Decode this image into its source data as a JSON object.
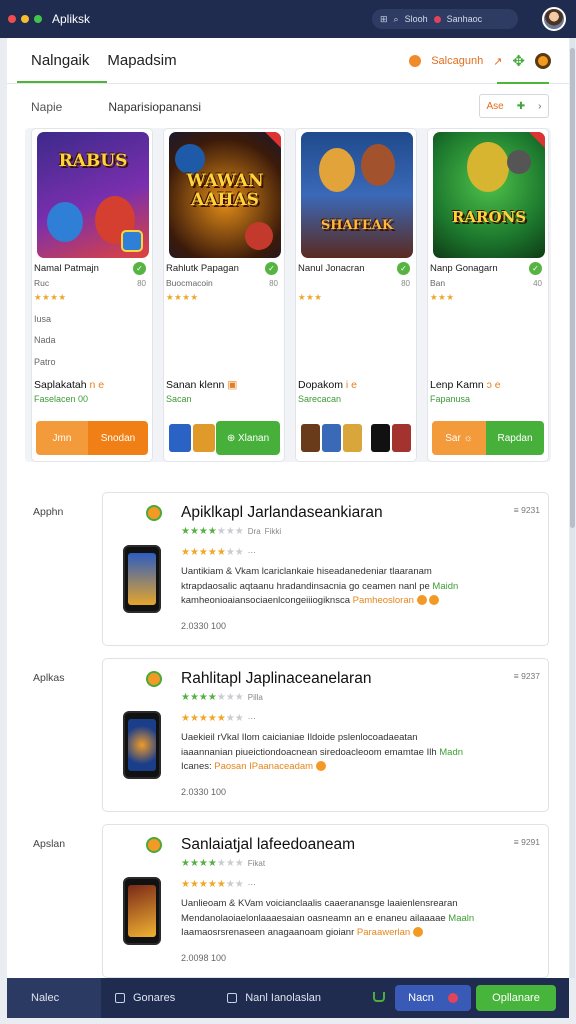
{
  "window": {
    "title": "Apliksk",
    "search_text": "Slooh",
    "record_text": "Sanhaoc"
  },
  "tabs": [
    {
      "label": "Nalngaik"
    },
    {
      "label": "Mapadsim"
    }
  ],
  "tab_actions": {
    "label": "Salcagunh"
  },
  "filter": {
    "left": "Napie",
    "title": "Naparisiopanansi",
    "button": "Ase"
  },
  "featured": [
    {
      "art_title": "RABUS",
      "name": "Namal Patmajn",
      "dev": "Ruc",
      "count": "80",
      "stars": "★★★★",
      "extra": [
        "Iusa",
        "Nada",
        "Patro"
      ],
      "title_main": "Saplakatah",
      "title_acc": "n e",
      "sub": "Faselacen 00",
      "btn1": "Jmn",
      "btn2": "Snodan",
      "art_colors": [
        "#3c2a8a",
        "#e0433b",
        "#2f7fd6"
      ]
    },
    {
      "art_title": "WAWAN AAHAS",
      "name": "Rahlutk Papagan",
      "dev": "Buocmacoin",
      "count": "80",
      "stars": "★★★★",
      "extra": [],
      "title_main": "Sanan klenn",
      "title_acc": "",
      "sub": "Sacan",
      "btn1": "",
      "btn2": "Xlanan",
      "art_colors": [
        "#1a1a2e",
        "#e38d18",
        "#c33a2c"
      ]
    },
    {
      "art_title": "SHAFEAK",
      "name": "Nanul Jonacran",
      "dev": "",
      "count": "80",
      "stars": "★★★",
      "extra": [],
      "title_main": "Dopakom",
      "title_acc": "i e",
      "sub": "Sarecacan",
      "btn1": "",
      "btn2": "",
      "art_colors": [
        "#1f4a8c",
        "#e2a33a",
        "#5a2a1f"
      ]
    },
    {
      "art_title": "RARONS",
      "name": "Nanp Gonagarn",
      "dev": "Ban",
      "count": "40",
      "stars": "★★★",
      "extra": [],
      "title_main": "Lenp Kamn",
      "title_acc": "ɔ e",
      "sub": "Fapanusa",
      "btn1": "Sar",
      "btn2": "Rapdan",
      "art_colors": [
        "#1d7a2e",
        "#d8b531",
        "#6a3b1b"
      ]
    }
  ],
  "list": [
    {
      "label": "Apphn",
      "title": "Apiklkapl Jarlandaseankiaran",
      "meta": "≡ 9231",
      "rating_sub": "Fikki",
      "rating_sub2": "Dra",
      "desc1": "Uantikiam & Vkam lcariclankaie hiseadanedeniar tlaaranam",
      "desc2": "ktrapdaosalic aqtaanu hradandinsacnia go ceamen nanl pe ",
      "desc2_acc": "Maidn",
      "desc3": "kamheonioaiansociaenlcongeiiiogiknsca ",
      "desc3_acc": "Pamheosloran",
      "date": "2.0330 100",
      "screen": [
        "#2d5cc0",
        "#e5a52c"
      ]
    },
    {
      "label": "Aplkas",
      "title": "Rahlitapl Japlinaceanelaran",
      "meta": "≡ 9237",
      "rating_sub": "Pilla",
      "rating_sub2": "",
      "desc1": "Uaekieil rVkal Ilom caicianiae Ildoide pslenlocoadaeatan",
      "desc2": "iaaannanian piueictiondoacnean siredoacleoom emamtae Ilh ",
      "desc2_acc": "Madn",
      "desc3": "Icanes: ",
      "desc3_acc": "Paosan IPaanaceadam",
      "date": "2.0330 100",
      "screen": [
        "#1b3e8a",
        "#ef9b2a"
      ]
    },
    {
      "label": "Apslan",
      "title": "Sanlaiatjal lafeedoaneam",
      "meta": "≡ 9291",
      "rating_sub": "Fikat",
      "rating_sub2": "",
      "desc1": "Uanlieoam & KVam voicianclaalis caaeranansge laaienlensrearan",
      "desc2": "Mendanolaoiaelonlaaaesaian oasneamn an e enaneu ailaaaae ",
      "desc2_acc": "Maaln",
      "desc3": "Iaamaosrsrenaseen anagaanoam gioianr ",
      "desc3_acc": "Paraawerlan",
      "date": "2.0098 100",
      "screen": [
        "#7a2a18",
        "#f2b232"
      ]
    }
  ],
  "bottom": {
    "first": "Nalec",
    "item1": "Gonares",
    "item2": "Nanl Ianolaslan",
    "btn1": "Nacn",
    "btn2": "Opllanare"
  }
}
